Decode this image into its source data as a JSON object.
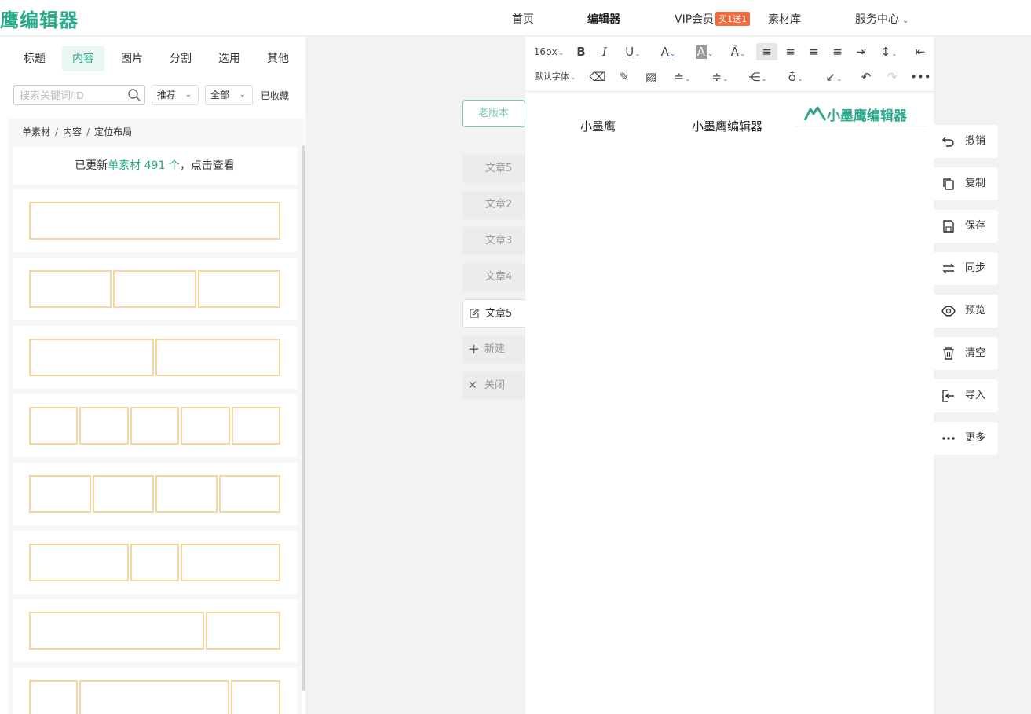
{
  "app": {
    "logo": "鹰编辑器",
    "brand_color": "#2aa88a"
  },
  "nav": {
    "home": "首页",
    "editor": "编辑器",
    "vip": "VIP会员",
    "vip_badge": "买1送1",
    "materials": "素材库",
    "service": "服务中心"
  },
  "left": {
    "tabs": [
      "标题",
      "内容",
      "图片",
      "分割",
      "选用",
      "其他"
    ],
    "active_tab": "内容",
    "search_placeholder": "搜索关键词/ID",
    "filter_recommend": "推荐",
    "filter_all": "全部",
    "favorites": "已收藏",
    "breadcrumb": [
      "单素材",
      "内容",
      "定位布局"
    ],
    "update_prefix": "已更新",
    "update_highlight": "单素材 491 个",
    "update_suffix": "，点击查看"
  },
  "center": {
    "old_version": "老版本",
    "articles": [
      "文章5",
      "文章2",
      "文章3",
      "文章4",
      "文章5"
    ],
    "active_article": "文章5",
    "new_label": "新建",
    "close_label": "关闭"
  },
  "editor": {
    "font_size": "16px",
    "font_family": "默认字体",
    "brand_text": "小墨鹰编辑器",
    "text_left": "小墨鹰",
    "text_right": "小墨鹰编辑器"
  },
  "actions": [
    "撤销",
    "复制",
    "保存",
    "同步",
    "预览",
    "清空",
    "导入",
    "更多"
  ]
}
